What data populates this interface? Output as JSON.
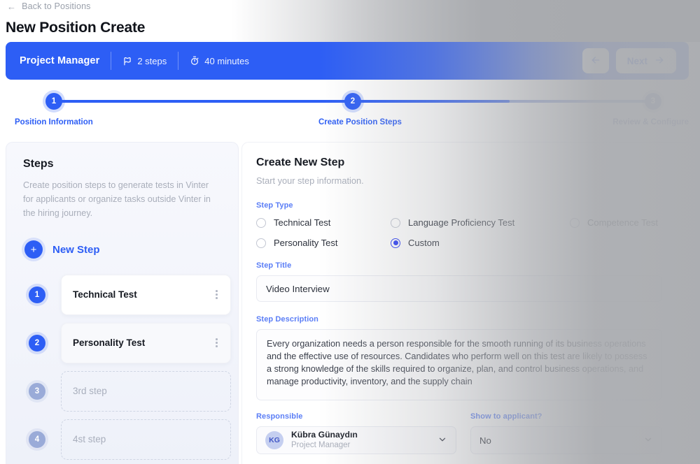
{
  "breadcrumb": {
    "back_label": "Back to Positions",
    "back_icon": "arrow-left-icon"
  },
  "page": {
    "title": "New Position Create"
  },
  "header_bar": {
    "position_name": "Project Manager",
    "steps_meta": "2 steps",
    "steps_icon": "flag-steps-icon",
    "duration_meta": "40 minutes",
    "duration_icon": "stopwatch-icon",
    "back_button": "",
    "back_button_icon": "arrow-left-icon",
    "next_button": "Next",
    "next_button_icon": "arrow-right-icon",
    "accent_color": "#2d5ef5"
  },
  "stepper": {
    "steps": [
      {
        "number": "1",
        "label": "Position Information",
        "state": "complete"
      },
      {
        "number": "2",
        "label": "Create Position Steps",
        "state": "active"
      },
      {
        "number": "3",
        "label": "Review & Configure",
        "state": "pending"
      }
    ],
    "active_color": "#2d5ef5",
    "pending_color": "#8b9ccd"
  },
  "steps_panel": {
    "title": "Steps",
    "description": "Create position steps to generate tests in Vinter for applicants or organize tasks outside Vinter in the hiring journey.",
    "new_step_label": "New Step",
    "new_step_icon": "plus-icon",
    "items": [
      {
        "number": "1",
        "label": "Technical Test",
        "filled": true
      },
      {
        "number": "2",
        "label": "Personality Test",
        "filled": true
      },
      {
        "number": "3",
        "label": "3rd step",
        "filled": false
      },
      {
        "number": "4",
        "label": "4st step",
        "filled": false
      }
    ]
  },
  "form": {
    "title": "Create New Step",
    "subtitle": "Start your step information.",
    "step_type_label": "Step Type",
    "step_type_options": [
      {
        "label": "Technical Test",
        "checked": false
      },
      {
        "label": "Language Proficiency Test",
        "checked": false
      },
      {
        "label": "Competence Test",
        "checked": false
      },
      {
        "label": "Personality Test",
        "checked": false
      },
      {
        "label": "Custom",
        "checked": true
      }
    ],
    "step_title_label": "Step  Title",
    "step_title_value": "Video Interview",
    "step_description_label": "Step Description",
    "step_description_value": "Every organization needs a person responsible for the smooth running of its business operations and the effective use of resources. Candidates who perform well on this test are likely to possess a strong knowledge of the skills required to organize, plan, and control business operations, and manage productivity, inventory, and the supply chain",
    "responsible_label": "Responsible",
    "responsible_initials": "KG",
    "responsible_name": "Kübra Günaydın",
    "responsible_role": "Project Manager",
    "show_to_applicant_label": "Show to applicant?",
    "show_to_applicant_value": "No",
    "chevron_icon": "chevron-down-icon"
  }
}
